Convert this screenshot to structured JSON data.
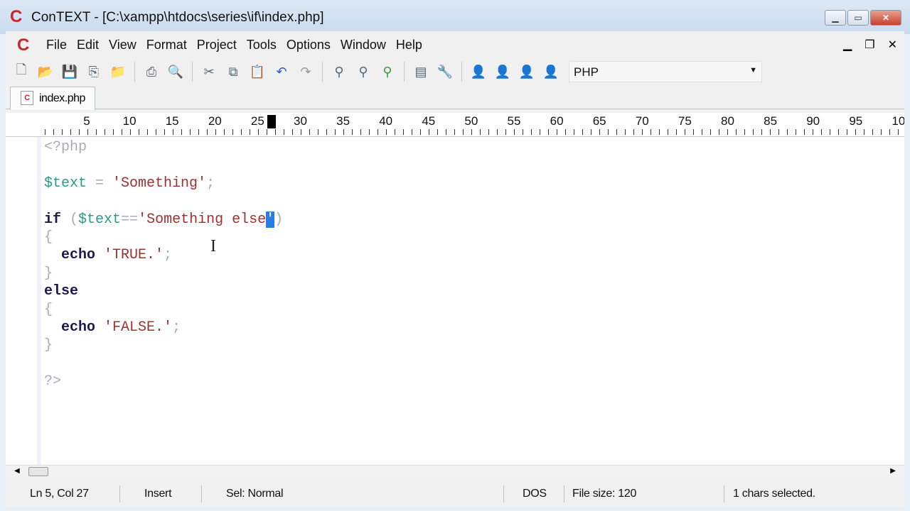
{
  "window": {
    "title": "ConTEXT - [C:\\xampp\\htdocs\\series\\if\\index.php]",
    "logo": "C"
  },
  "menu": [
    "File",
    "Edit",
    "View",
    "Format",
    "Project",
    "Tools",
    "Options",
    "Window",
    "Help"
  ],
  "toolbar": {
    "language": "PHP",
    "icons": [
      "new-file-icon",
      "open-icon",
      "save-icon",
      "save-all-icon",
      "open-folder-icon",
      "print-icon",
      "print-preview-icon",
      "cut-icon",
      "copy-icon",
      "paste-icon",
      "undo-icon",
      "redo-icon",
      "find-icon",
      "find-next-icon",
      "replace-icon",
      "file-info-icon",
      "tools-icon",
      "user-1-icon",
      "user-2-icon",
      "user-3-icon",
      "user-4-icon"
    ]
  },
  "tab": {
    "label": "index.php"
  },
  "ruler": [
    "5",
    "10",
    "15",
    "20",
    "25",
    "30",
    "35",
    "40",
    "45",
    "50",
    "55",
    "60",
    "65",
    "70",
    "75",
    "80",
    "85",
    "90",
    "95",
    "10"
  ],
  "code": {
    "l1": "<?php",
    "l3_var": "$text",
    "l3_op": " = ",
    "l3_str": "'Something'",
    "l3_end": ";",
    "l5_kw": "if",
    "l5_p": " (",
    "l5_var": "$text",
    "l5_op": "==",
    "l5_str": "'Something else",
    "l5_sel": "'",
    "l5_end": ")",
    "brace_open": "{",
    "echo": "echo",
    "true_str": "'TRUE.'",
    "semi": ";",
    "brace_close": "}",
    "else": "else",
    "false_str": "'FALSE.'",
    "close": "?>"
  },
  "status": {
    "position": "Ln 5, Col 27",
    "mode": "Insert",
    "sel": "Sel: Normal",
    "eol": "DOS",
    "size": "File size: 120",
    "selected": "1 chars selected."
  }
}
